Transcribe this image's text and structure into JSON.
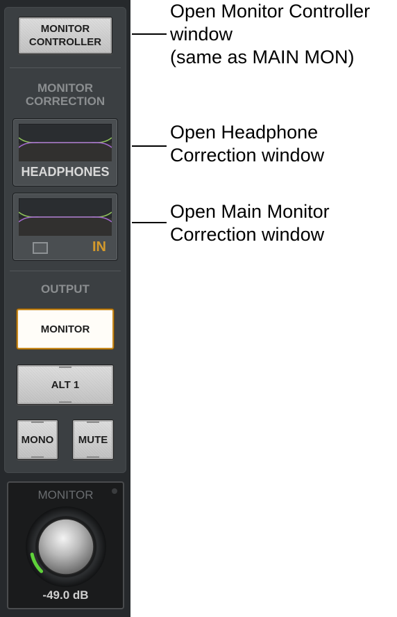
{
  "strip": {
    "monitor_controller_button": "MONITOR\nCONTROLLER",
    "monitor_correction_label": "MONITOR\nCORRECTION",
    "headphones_label": "HEADPHONES",
    "main_correction_in": "IN",
    "output_label": "OUTPUT",
    "output_monitor_button": "MONITOR",
    "alt1_button": "ALT 1",
    "mono_button": "MONO",
    "mute_button": "MUTE",
    "knob_title": "MONITOR",
    "knob_value": "-49.0 dB",
    "knob_level_fraction": 0.12
  },
  "annotations": {
    "monitor_controller": "Open Monitor Controller\nwindow\n(same as MAIN MON)",
    "headphone_correction": "Open Headphone\nCorrection window",
    "main_monitor_correction": "Open Main Monitor\nCorrection window"
  },
  "colors": {
    "active_outline": "#c98a20",
    "in_text": "#d49a2c",
    "level_arc": "#5fd13a",
    "curve_green": "#8fc25a",
    "curve_purple": "#a46ad0"
  }
}
